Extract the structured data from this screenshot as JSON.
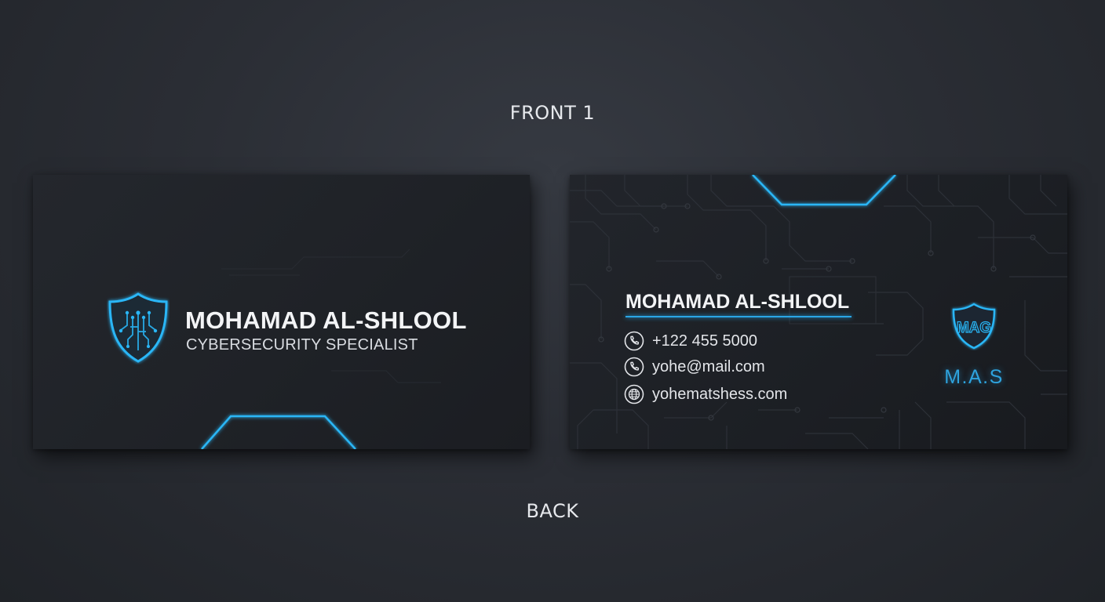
{
  "captions": {
    "front": "FRONT 1",
    "back": "BACK"
  },
  "front_card": {
    "name": "MOHAMAD AL-SHLOOL",
    "title": "CYBERSECURITY SPECIALIST",
    "logo_icon": "circuit-shield-icon"
  },
  "back_card": {
    "name": "MOHAMAD AL-SHLOOL",
    "contacts": [
      {
        "icon": "phone-icon",
        "text": "+122 455 5000"
      },
      {
        "icon": "phone-icon",
        "text": "yohe@mail.com"
      },
      {
        "icon": "globe-icon",
        "text": "yohematshess.com"
      }
    ],
    "monogram": "MAG",
    "initials": "M.A.S"
  },
  "colors": {
    "accent": "#29b6f6",
    "background": "#2b2e35",
    "card": "#1f2227",
    "text": "#f3f4f6"
  }
}
